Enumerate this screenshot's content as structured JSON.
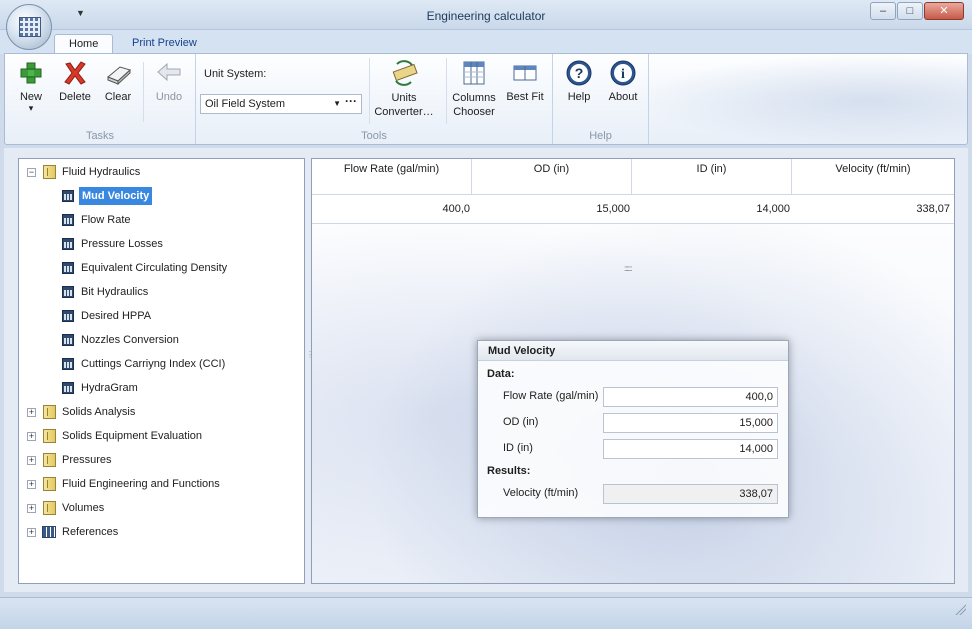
{
  "window": {
    "title": "Engineering calculator",
    "qat_arrow": "▼",
    "controls": [
      "–",
      "□",
      "✕"
    ]
  },
  "tabs": [
    {
      "label": "Home",
      "active": true
    },
    {
      "label": "Print Preview",
      "active": false
    }
  ],
  "ribbon": {
    "groups": {
      "tasks": "Tasks",
      "tools": "Tools",
      "help": "Help"
    },
    "buttons": {
      "new": "New",
      "new_arrow": "▾",
      "delete": "Delete",
      "clear": "Clear",
      "undo": "Undo",
      "units_converter_1": "Units",
      "units_converter_2": "Converter…",
      "columns_chooser_1": "Columns",
      "columns_chooser_2": "Chooser",
      "best_fit": "Best Fit",
      "help": "Help",
      "about": "About",
      "help_glyph": "?",
      "about_glyph": "i"
    },
    "unit_system_label": "Unit System:",
    "unit_system_value": "Oil Field System",
    "unit_system_arrow": "▼",
    "unit_system_dots": "···"
  },
  "tree": {
    "items": [
      {
        "label": "Fluid Hydraulics",
        "type": "folder",
        "expanded": true,
        "expander": "−"
      },
      {
        "label": "Mud Velocity",
        "type": "calc",
        "selected": true
      },
      {
        "label": "Flow Rate",
        "type": "calc"
      },
      {
        "label": "Pressure Losses",
        "type": "calc"
      },
      {
        "label": "Equivalent Circulating Density",
        "type": "calc"
      },
      {
        "label": "Bit Hydraulics",
        "type": "calc"
      },
      {
        "label": "Desired HPPA",
        "type": "calc"
      },
      {
        "label": "Nozzles Conversion",
        "type": "calc"
      },
      {
        "label": "Cuttings Carriyng Index (CCI)",
        "type": "calc"
      },
      {
        "label": "HydraGram",
        "type": "calc"
      },
      {
        "label": "Solids Analysis",
        "type": "folder",
        "expander": "+"
      },
      {
        "label": "Solids Equipment Evaluation",
        "type": "folder",
        "expander": "+"
      },
      {
        "label": "Pressures",
        "type": "folder",
        "expander": "+"
      },
      {
        "label": "Fluid Engineering and Functions",
        "type": "folder",
        "expander": "+"
      },
      {
        "label": "Volumes",
        "type": "folder",
        "expander": "+"
      },
      {
        "label": "References",
        "type": "refs",
        "expander": "+"
      }
    ]
  },
  "grid": {
    "headers": [
      "Flow Rate (gal/min)",
      "OD (in)",
      "ID (in)",
      "Velocity (ft/min)"
    ],
    "values": [
      "400,0",
      "15,000",
      "14,000",
      "338,07"
    ]
  },
  "panel": {
    "title": "Mud Velocity",
    "data_label": "Data:",
    "results_label": "Results:",
    "fields": [
      {
        "label": "Flow Rate (gal/min)",
        "value": "400,0"
      },
      {
        "label": "OD (in)",
        "value": "15,000"
      },
      {
        "label": "ID (in)",
        "value": "14,000"
      }
    ],
    "result": {
      "label": "Velocity (ft/min)",
      "value": "338,07"
    }
  },
  "splitter_glyph": "⋮",
  "mid_dots": "::::::"
}
